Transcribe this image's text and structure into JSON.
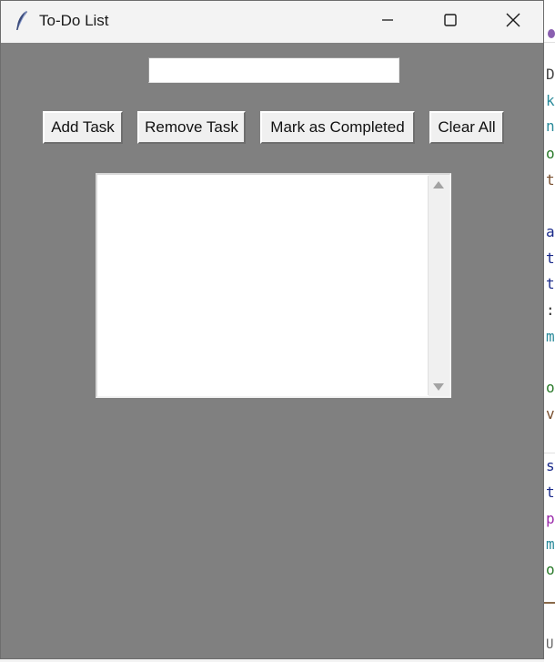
{
  "window": {
    "title": "To-Do List",
    "background_color": "#808080",
    "icons": {
      "app": "feather-icon",
      "minimize": "minimize-icon",
      "maximize": "maximize-icon",
      "close": "close-icon"
    }
  },
  "entry": {
    "value": "",
    "placeholder": ""
  },
  "buttons": {
    "add": "Add Task",
    "remove": "Remove Task",
    "mark": "Mark as Completed",
    "clear": "Clear All"
  },
  "task_list": {
    "items": []
  },
  "background_editor_glyphs": [
    "D",
    "k",
    "n",
    "o",
    "t",
    "a",
    "t",
    "t",
    ":",
    "m",
    "o",
    "v",
    "s",
    "t",
    "p",
    "m",
    "o",
    "U"
  ]
}
